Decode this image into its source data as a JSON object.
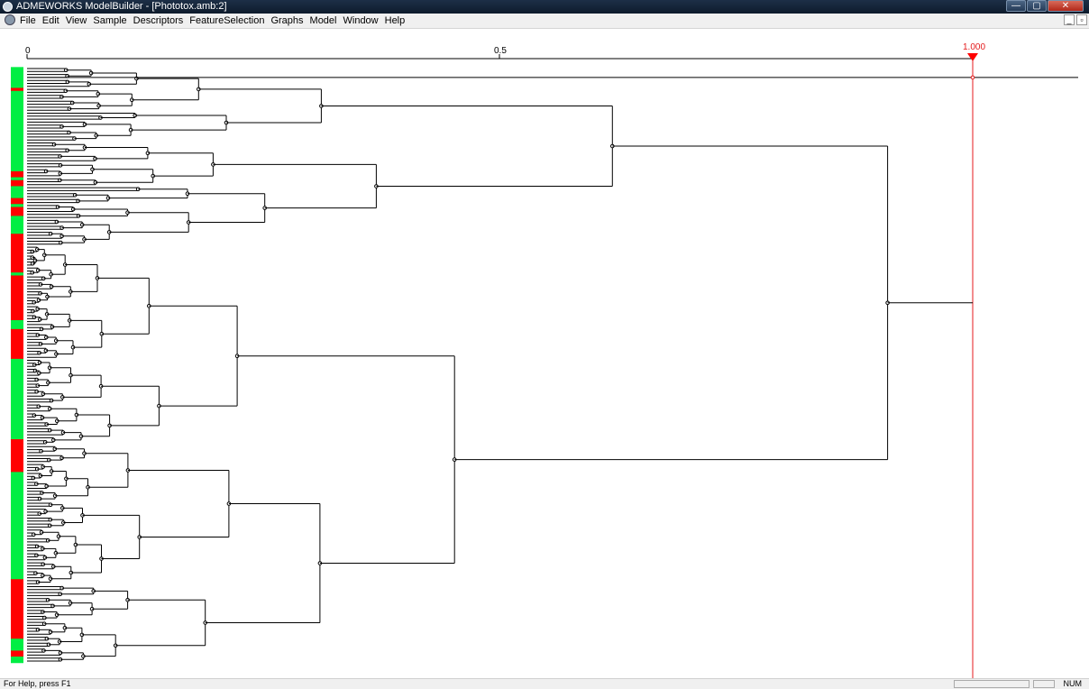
{
  "window": {
    "title": "ADMEWORKS ModelBuilder - [Phototox.amb:2]",
    "controls": [
      "—",
      "▢",
      "✕"
    ]
  },
  "menu": {
    "items": [
      "File",
      "Edit",
      "View",
      "Sample",
      "Descriptors",
      "FeatureSelection",
      "Graphs",
      "Model",
      "Window",
      "Help"
    ],
    "mdi_controls": [
      "_",
      "▫"
    ]
  },
  "scale": {
    "tick_labels": [
      "0",
      "0.5"
    ],
    "threshold_label": "1.000",
    "threshold_value": 1.0
  },
  "dendrogram": {
    "class_colors": {
      "positive": "#ff0000",
      "negative": "#00ee44",
      "threshold": "#e41a1c",
      "line": "#000000"
    },
    "class_strip": "GGGGGGGRGGGGGGGGGGGGGGGGGGGGGGGGGGGRRGRRGGGGRRGRRRGGGGGGRRRRRRRRRRRRRGRRRRRRRRRRRRRRRGGGRRRRRRRRRRGGGGGGGGGGGGGGGGGGGGGGGGGGGRRRRRRRRRRRGGGGGGGGGGGGGGGGGGGGGGGGGGGGGGGGGGGGRRRRRRRRRRRRRRRRRRRRGGGGRRGG"
  },
  "status": {
    "help": "For Help, press F1",
    "indicator": "NUM"
  }
}
